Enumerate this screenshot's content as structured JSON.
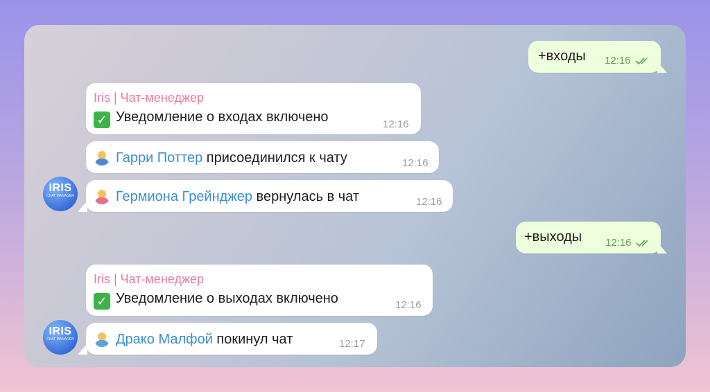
{
  "messages": [
    {
      "id": "m1",
      "direction": "out",
      "text": "+входы",
      "time": "12:16"
    },
    {
      "id": "m2",
      "direction": "in",
      "sender": "Iris | Чат-менеджер",
      "emoji": "check-mark",
      "text": "Уведомление о входах включено",
      "time": "12:16"
    },
    {
      "id": "m3",
      "direction": "in",
      "emoji": "man-person",
      "name": "Гарри Поттер",
      "text": " присоединился к чату",
      "time": "12:16"
    },
    {
      "id": "m4",
      "direction": "in",
      "emoji": "woman-person",
      "name": "Гермиона Грейнджер",
      "text": " вернулась в чат",
      "time": "12:16"
    },
    {
      "id": "m5",
      "direction": "out",
      "text": "+выходы",
      "time": "12:16"
    },
    {
      "id": "m6",
      "direction": "in",
      "sender": "Iris | Чат-менеджер",
      "emoji": "check-mark",
      "text": "Уведомление о выходах включено",
      "time": "12:16"
    },
    {
      "id": "m7",
      "direction": "in",
      "emoji": "man-gesturing-no",
      "name": "Драко Малфой",
      "text": " покинул чат",
      "time": "12:17"
    }
  ],
  "avatar": {
    "logo_text": "IRIS",
    "logo_subtext": "CHAT MANAGER"
  },
  "colors": {
    "outgoing_bubble": "#eeffde",
    "incoming_bubble": "#ffffff",
    "sender_name": "#e77ba1",
    "user_link": "#3a8ed0",
    "outgoing_time": "#5da549"
  }
}
